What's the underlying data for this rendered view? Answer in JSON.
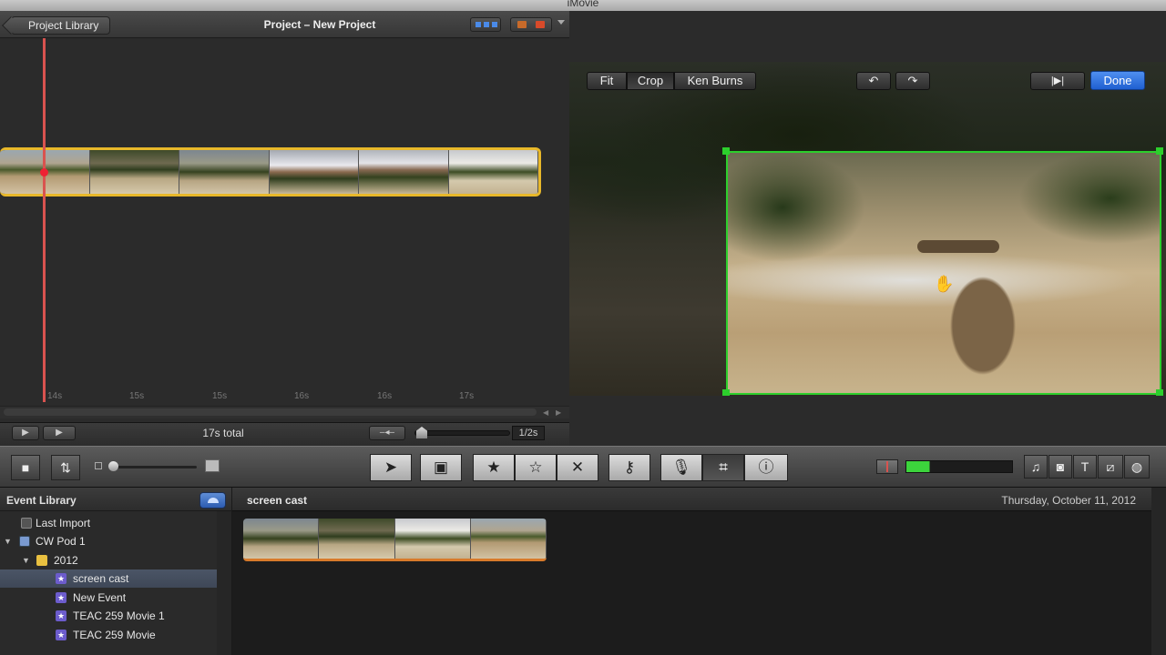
{
  "window": {
    "title": "iMovie"
  },
  "project": {
    "library_button": "Project Library",
    "title": "Project – New Project",
    "ruler_ticks": [
      "14s",
      "15s",
      "15s",
      "16s",
      "16s",
      "17s"
    ],
    "total": "17s total",
    "zoom_label": "1/2s"
  },
  "viewer": {
    "mode_buttons": [
      "Fit",
      "Crop",
      "Ken Burns"
    ],
    "active_mode": "Crop",
    "undo_icon": "rotate-left-icon",
    "redo_icon": "rotate-right-icon",
    "play_icon": "play-clip-icon",
    "done_label": "Done",
    "crop_color": "#2ccf2c"
  },
  "toolbar": {
    "camera_icon": "camera-icon",
    "swap_icon": "swap-icon",
    "tools": [
      "select-arrow-icon",
      "add-to-project-icon",
      "favorite-icon",
      "unmark-icon",
      "reject-icon",
      "keyword-icon",
      "voiceover-icon",
      "crop-icon",
      "inspector-icon"
    ],
    "media_icons": [
      "music-icon",
      "photo-icon",
      "title-icon",
      "transition-icon",
      "map-icon"
    ]
  },
  "event_library": {
    "title": "Event Library",
    "items": [
      {
        "label": "Last Import",
        "icon": "film-icon"
      },
      {
        "label": "CW Pod 1",
        "icon": "computer-icon"
      },
      {
        "label": "2012",
        "icon": "folder-icon"
      },
      {
        "label": "screen cast",
        "icon": "star-event-icon"
      },
      {
        "label": "New Event",
        "icon": "star-event-icon"
      },
      {
        "label": "TEAC 259 Movie 1",
        "icon": "star-event-icon"
      },
      {
        "label": "TEAC 259 Movie",
        "icon": "star-event-icon"
      }
    ],
    "selected": "screen cast"
  },
  "event_browser": {
    "event_name": "screen cast",
    "date": "Thursday, October 11, 2012"
  },
  "colors": {
    "accent": "#e8b82a",
    "playhead": "#d9534f",
    "done": "#2f6fe0",
    "clip_bar": "#d87a2a"
  }
}
